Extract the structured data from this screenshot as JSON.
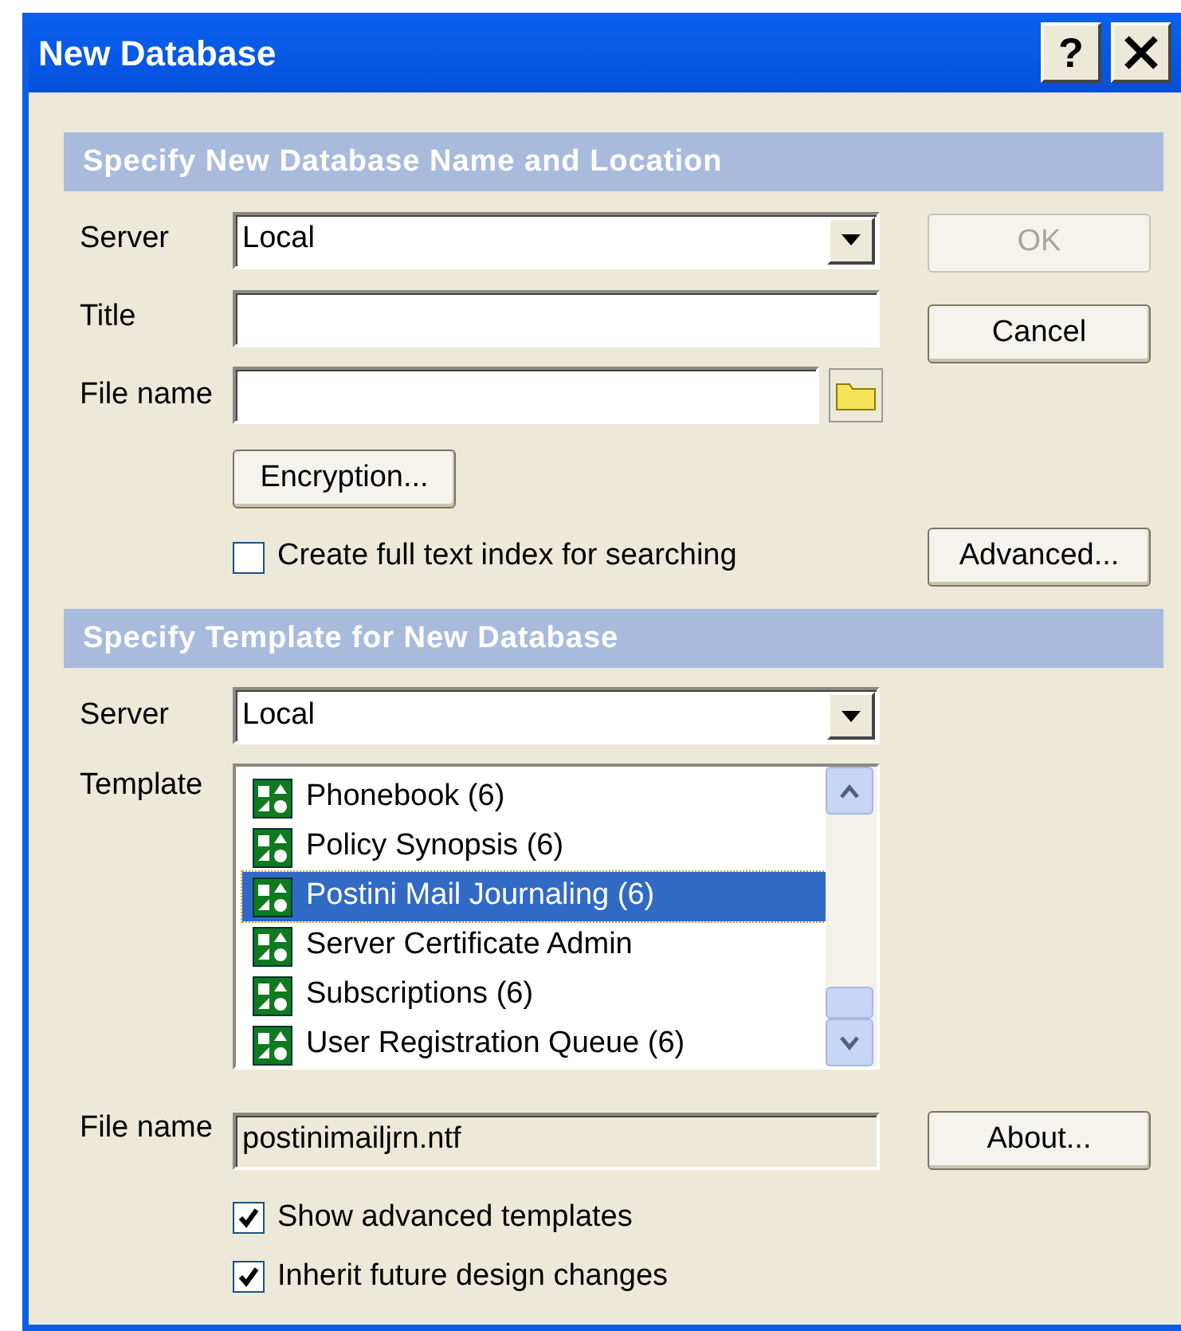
{
  "window": {
    "title": "New Database",
    "help_button": "?"
  },
  "database": {
    "heading": "Specify New Database Name and Location",
    "fields": [
      {
        "kind": "combo",
        "label": "Server",
        "value": "Local"
      },
      {
        "kind": "text",
        "label": "Title"
      },
      {
        "kind": "file",
        "label": "File name"
      }
    ],
    "encryption_button": {
      "label": "Encryption...",
      "disabled": false
    },
    "full_text_index": {
      "label": "Create full text index for searching",
      "checked": false
    },
    "buttons": [
      {
        "label": "OK",
        "disabled": true
      },
      {
        "label": "Cancel",
        "disabled": false
      }
    ],
    "advanced_button": {
      "label": "Advanced...",
      "disabled": false
    }
  },
  "template": {
    "heading": "Specify Template for New Database",
    "server": {
      "label": "Server",
      "value": "Local"
    },
    "list_label": "Template",
    "items": [
      {
        "name": "Phonebook (6)",
        "selected": false
      },
      {
        "name": "Policy Synopsis (6)",
        "selected": false
      },
      {
        "name": "Postini Mail Journaling (6)",
        "selected": true
      },
      {
        "name": "Server Certificate Admin",
        "selected": false
      },
      {
        "name": "Subscriptions (6)",
        "selected": false
      },
      {
        "name": "User Registration Queue (6)",
        "selected": false
      }
    ],
    "file_name": {
      "label": "File name",
      "value": "postinimailjrn.ntf",
      "disabled": true
    },
    "about_button": {
      "label": "About...",
      "disabled": false
    },
    "options": [
      {
        "label": "Show advanced templates",
        "checked": true
      },
      {
        "label": "Inherit future design changes",
        "checked": true
      }
    ]
  }
}
